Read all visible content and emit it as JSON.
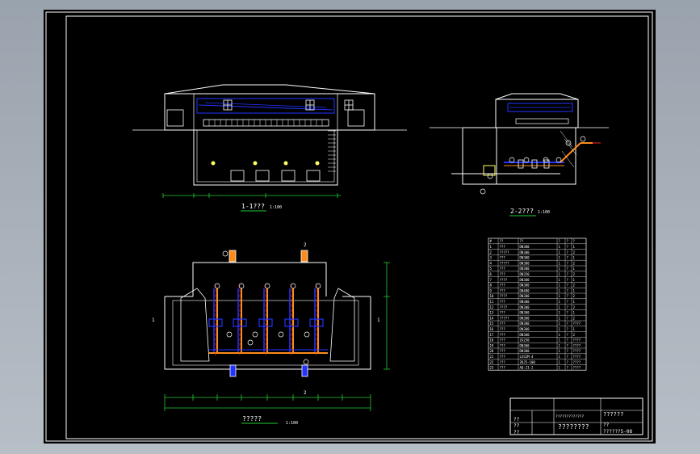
{
  "section_1": {
    "title": "1-1???",
    "scale": "1:100"
  },
  "section_2": {
    "title": "2-2???",
    "scale": "1:100"
  },
  "plan": {
    "title": "?????",
    "scale": "1:100",
    "marker_1": "1",
    "marker_2": "2"
  },
  "material_table": {
    "headers": [
      "#",
      "??",
      "??",
      "?",
      "?",
      "?"
    ],
    "rows": [
      [
        "1",
        "???",
        "DN300",
        "1",
        "?",
        "1"
      ],
      [
        "2",
        "?????",
        "DN300",
        "1",
        "?",
        "2"
      ],
      [
        "3",
        "???",
        "DN300",
        "1",
        "?",
        "1"
      ],
      [
        "4",
        "?????",
        "DN300",
        "1",
        "?",
        "2"
      ],
      [
        "5",
        "???",
        "DN300",
        "1",
        "?",
        "1"
      ],
      [
        "6",
        "???",
        "DN350",
        "1",
        "?",
        "2"
      ],
      [
        "7",
        "????",
        "DN300",
        "1",
        "?",
        "1"
      ],
      [
        "8",
        "???",
        "DN300",
        "1",
        "?",
        "2"
      ],
      [
        "9",
        "???",
        "DN400",
        "1",
        "?",
        "1"
      ],
      [
        "10",
        "????",
        "DN300",
        "1",
        "?",
        "2"
      ],
      [
        "11",
        "???",
        "DN300",
        "1",
        "?",
        "1"
      ],
      [
        "12",
        "????",
        "DN300",
        "1",
        "?",
        "2"
      ],
      [
        "13",
        "???",
        "DN300",
        "1",
        "?",
        "1"
      ],
      [
        "14",
        "?????",
        "DN300",
        "1",
        "?",
        "2"
      ],
      [
        "15",
        "???",
        "DN300",
        "1",
        "?",
        "????"
      ],
      [
        "16",
        "???",
        "DN300",
        "1",
        "?",
        "1"
      ],
      [
        "17",
        "???",
        "DN300",
        "1",
        "?",
        "2"
      ],
      [
        "18",
        "???",
        "ZA250",
        "1",
        "?",
        "????"
      ],
      [
        "19",
        "???",
        "DN300",
        "1",
        "?",
        "????"
      ],
      [
        "20",
        "???",
        "DN300",
        "1",
        "?",
        "????"
      ],
      [
        "21",
        "???",
        "LXS2M-4",
        "1",
        "?",
        "????"
      ],
      [
        "22",
        "???",
        "ZKJ5-100",
        "1",
        "?",
        "????"
      ],
      [
        "23",
        "???",
        "AQ-21-2",
        "1",
        "?",
        "????"
      ]
    ]
  },
  "title_block": {
    "project": "?????????????",
    "main_title": "??????",
    "label_design": "??",
    "label_check": "??",
    "label_review": "??",
    "drawing_name": "????????",
    "date_label": "??",
    "drawing_no": "??????5-08"
  },
  "colors": {
    "line": "#ffffff",
    "dim": "#22cc33",
    "pipe_blue": "#2233ff",
    "pipe_orange": "#ff8c1a",
    "centerline": "#ff2020",
    "label_bubble": "#ffff66",
    "title_underline": "#22cc33"
  }
}
